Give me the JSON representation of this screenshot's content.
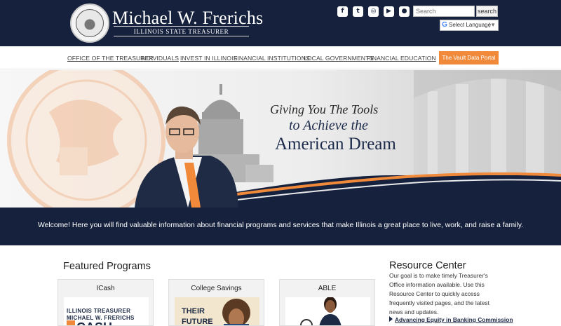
{
  "header": {
    "title": "Michael W. Frerichs",
    "subtitle": "ILLINOIS STATE TREASURER",
    "social": [
      {
        "name": "facebook-icon",
        "glyph": "f"
      },
      {
        "name": "twitter-icon",
        "glyph": "t"
      },
      {
        "name": "instagram-icon",
        "glyph": "◎"
      },
      {
        "name": "youtube-icon",
        "glyph": "▶"
      },
      {
        "name": "flickr-icon",
        "glyph": "●"
      }
    ],
    "search": {
      "placeholder": "Search",
      "button": "search"
    },
    "language": "Select Language"
  },
  "nav": {
    "items": [
      "OFFICE OF THE TREASURER",
      "INDIVIDUALS",
      "INVEST IN ILLINOIS",
      "FINANCIAL INSTITUTIONS",
      "LOCAL GOVERNMENTS",
      "FINANCIAL EDUCATION"
    ],
    "cta": "The Vault Data Portal"
  },
  "hero": {
    "line1": "Giving You The Tools",
    "line2": "to Achieve the",
    "line3": "American Dream"
  },
  "welcome": "Welcome! Here you will find valuable information about financial programs and services that make Illinois a great place to live, work, and raise a family.",
  "featured": {
    "title": "Featured Programs",
    "cards": [
      {
        "title": "ICash"
      },
      {
        "title": "College Savings"
      },
      {
        "title": "ABLE"
      }
    ],
    "icash_img": {
      "l1": "ILLINOIS TREASURER",
      "l2": "MICHAEL W. FRERICHS",
      "l3": "CASH"
    },
    "cs_img": {
      "l1": "THEIR",
      "l2": "FUTURE"
    }
  },
  "resource": {
    "title": "Resource Center",
    "description": "Our goal is to make timely Treasurer's Office information available. Use this Resource Center to quickly access frequently visited pages, and the latest news and updates.",
    "link": "Advancing Equity in Banking Commission"
  },
  "colors": {
    "navy": "#16223d",
    "accent": "#f08a3a"
  }
}
